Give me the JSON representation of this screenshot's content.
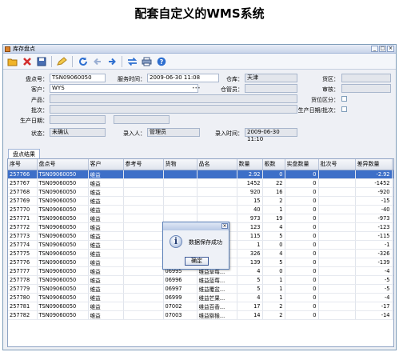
{
  "page_title": "配套自定义的WMS系统",
  "window": {
    "title": "库存盘点"
  },
  "toolbar": {
    "icons": [
      "open-icon",
      "delete-icon",
      "save-icon",
      "edit-icon",
      "refresh-icon",
      "back-icon",
      "forward-icon",
      "swap-icon",
      "print-icon",
      "help-icon"
    ]
  },
  "form": {
    "count_no_label": "盘点号：",
    "count_no": "TSN09060050",
    "service_time_label": "服务时间：",
    "service_time": "2009-06-30 11:08",
    "warehouse_label": "仓库：",
    "warehouse": "天津",
    "zone_label": "货区：",
    "customer_label": "客户：",
    "customer": "WYS",
    "keeper_label": "仓管员：",
    "auditor_label": "审核：",
    "product_label": "产品：",
    "zone_split_label": "货位区分：",
    "batch_label": "批次：",
    "prod_date_batch_label": "生产日期/批次：",
    "prod_date_label": "生产日期：",
    "status_label": "状态：",
    "status": "未确认",
    "entered_by_label": "录入人：",
    "entered_by": "管理员",
    "entry_time_label": "录入时间：",
    "entry_time": "2009-06-30 11:10"
  },
  "tab": {
    "label": "盘点结果"
  },
  "table": {
    "columns": [
      "序号",
      "盘点号",
      "客户",
      "参考号",
      "货物",
      "品名",
      "数量",
      "板数",
      "实盘数量",
      "批次号",
      "差异数量",
      "产品"
    ],
    "rows": [
      [
        "257766",
        "TSN09060050",
        "维益",
        "",
        "",
        "",
        "2.92",
        "0",
        "0",
        "",
        "-2.92",
        "不良"
      ],
      [
        "257767",
        "TSN09060050",
        "维益",
        "",
        "",
        "",
        "1452",
        "22",
        "0",
        "",
        "-1452",
        "良品"
      ],
      [
        "257768",
        "TSN09060050",
        "维益",
        "",
        "",
        "",
        "920",
        "16",
        "0",
        "",
        "-920",
        "良品"
      ],
      [
        "257769",
        "TSN09060050",
        "维益",
        "",
        "",
        "",
        "15",
        "2",
        "0",
        "",
        "-15",
        "良品"
      ],
      [
        "257770",
        "TSN09060050",
        "维益",
        "",
        "",
        "",
        "40",
        "1",
        "0",
        "",
        "-40",
        "良品"
      ],
      [
        "257771",
        "TSN09060050",
        "维益",
        "",
        "",
        "",
        "973",
        "19",
        "0",
        "",
        "-973",
        "良品"
      ],
      [
        "257772",
        "TSN09060050",
        "维益",
        "",
        "05454",
        "维益奶油...",
        "123",
        "4",
        "0",
        "",
        "-123",
        "良品"
      ],
      [
        "257773",
        "TSN09060050",
        "维益",
        "",
        "05507",
        "维益蓝莓...",
        "115",
        "5",
        "0",
        "",
        "-115",
        "良品"
      ],
      [
        "257774",
        "TSN09060050",
        "维益",
        "",
        "05556",
        "维益巧克...",
        "1",
        "0",
        "0",
        "",
        "-1",
        "不良"
      ],
      [
        "257775",
        "TSN09060050",
        "维益",
        "",
        "05556",
        "维益巧克...",
        "326",
        "4",
        "0",
        "",
        "-326",
        "良品"
      ],
      [
        "257776",
        "TSN09060050",
        "维益",
        "",
        "06044",
        "金钻清纯...",
        "139",
        "5",
        "0",
        "",
        "-139",
        "良品"
      ],
      [
        "257777",
        "TSN09060050",
        "维益",
        "",
        "06995",
        "维益草莓...",
        "4",
        "0",
        "0",
        "",
        "-4",
        "良品"
      ],
      [
        "257778",
        "TSN09060050",
        "维益",
        "",
        "06996",
        "维益蓝莓...",
        "5",
        "1",
        "0",
        "",
        "-5",
        "良品"
      ],
      [
        "257779",
        "TSN09060050",
        "维益",
        "",
        "06997",
        "维益覆盆...",
        "5",
        "1",
        "0",
        "",
        "-5",
        "良品"
      ],
      [
        "257780",
        "TSN09060050",
        "维益",
        "",
        "06999",
        "维益芒果...",
        "4",
        "1",
        "0",
        "",
        "-4",
        "良品"
      ],
      [
        "257781",
        "TSN09060050",
        "维益",
        "",
        "07002",
        "维益百香...",
        "17",
        "2",
        "0",
        "",
        "-17",
        "良品"
      ],
      [
        "257782",
        "TSN09060050",
        "维益",
        "",
        "07003",
        "维益猕猴...",
        "14",
        "2",
        "0",
        "",
        "-14",
        "良品"
      ]
    ]
  },
  "dialog": {
    "close": "×",
    "icon": "i",
    "message": "数据保存成功",
    "ok": "确定"
  },
  "colors": {
    "selection": "#3d6fc8",
    "window_bg": "#eef0f5",
    "border": "#7f9db9"
  }
}
